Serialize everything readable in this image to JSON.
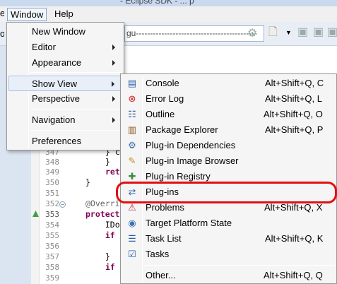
{
  "title_fragment": "- Eclipse SDK - ... p",
  "menubar": {
    "items": [
      {
        "label": "Window"
      },
      {
        "label": "Help"
      }
    ]
  },
  "left_edge_chars": {
    "menu": "e",
    "toolbar": "o"
  },
  "toolbar": {
    "combo_value": "gu-------------------------------------------"
  },
  "editor": {
    "line_numbers": [
      "347",
      "348",
      "349",
      "350",
      "351",
      "352",
      "353",
      "354",
      "355",
      "356",
      "357",
      "358",
      "359"
    ],
    "code_lines": [
      "} c",
      "}",
      "ret",
      "}",
      "",
      "@Overri",
      "protect",
      "  IDo",
      "  if",
      "",
      "}",
      "if",
      ""
    ]
  },
  "window_menu": {
    "items": [
      {
        "label": "New Window",
        "submenu": false
      },
      {
        "label": "Editor",
        "submenu": true
      },
      {
        "label": "Appearance",
        "submenu": true
      },
      {
        "label": "Show View",
        "submenu": true
      },
      {
        "label": "Perspective",
        "submenu": true
      },
      {
        "label": "Navigation",
        "submenu": true
      },
      {
        "label": "Preferences",
        "submenu": false
      }
    ]
  },
  "show_view_menu": {
    "items": [
      {
        "label": "Console",
        "shortcut": "Alt+Shift+Q, C",
        "icon": "console-icon"
      },
      {
        "label": "Error Log",
        "shortcut": "Alt+Shift+Q, L",
        "icon": "error-log-icon"
      },
      {
        "label": "Outline",
        "shortcut": "Alt+Shift+Q, O",
        "icon": "outline-icon"
      },
      {
        "label": "Package Explorer",
        "shortcut": "Alt+Shift+Q, P",
        "icon": "package-explorer-icon"
      },
      {
        "label": "Plug-in Dependencies",
        "shortcut": "",
        "icon": "plugin-dependencies-icon"
      },
      {
        "label": "Plug-in Image Browser",
        "shortcut": "",
        "icon": "image-browser-icon"
      },
      {
        "label": "Plug-in Registry",
        "shortcut": "",
        "icon": "plugin-registry-icon"
      },
      {
        "label": "Plug-ins",
        "shortcut": "",
        "icon": "plugins-icon"
      },
      {
        "label": "Problems",
        "shortcut": "Alt+Shift+Q, X",
        "icon": "problems-icon"
      },
      {
        "label": "Target Platform State",
        "shortcut": "",
        "icon": "target-platform-icon"
      },
      {
        "label": "Task List",
        "shortcut": "Alt+Shift+Q, K",
        "icon": "task-list-icon"
      },
      {
        "label": "Tasks",
        "shortcut": "",
        "icon": "tasks-icon"
      },
      {
        "label": "Other...",
        "shortcut": "Alt+Shift+Q, Q",
        "icon": ""
      }
    ]
  },
  "colors": {
    "highlight_ring": "#e01010",
    "menu_hover": "#e8eff8",
    "keyword": "#7f0055"
  }
}
